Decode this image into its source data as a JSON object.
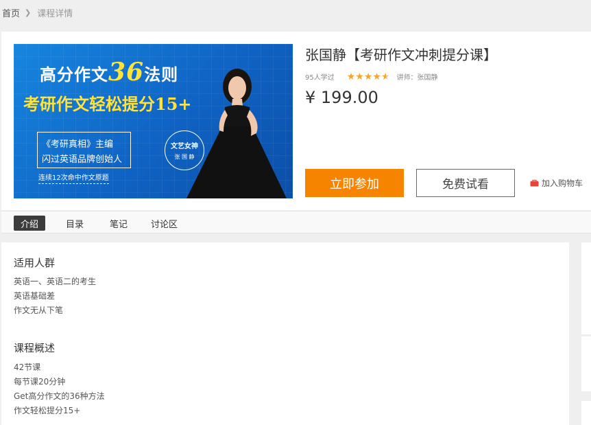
{
  "breadcrumb": {
    "home": "首页",
    "current": "课程详情"
  },
  "course": {
    "title": "张国静【考研作文冲刺提分课】",
    "learners": "95人学过",
    "rating_stars": 4.5,
    "teacher": "讲师：张国静",
    "price": "¥ 199.00",
    "join_label": "立即参加",
    "trial_label": "免费试看",
    "cart_label": "加入购物车"
  },
  "cover": {
    "line1_a": "高分作文",
    "line1_num": "36",
    "line1_b": "法则",
    "line2": "考研作文轻松提分15+",
    "box_line1": "《考研真相》主编",
    "box_line2": "闪过英语品牌创始人",
    "sub": "连续12次命中作文原题",
    "seal_line1": "文艺女神",
    "seal_line2": "张 国 静"
  },
  "tabs": [
    {
      "label": "介绍"
    },
    {
      "label": "目录"
    },
    {
      "label": "笔记"
    },
    {
      "label": "讨论区"
    }
  ],
  "sections": {
    "audience": {
      "title": "适用人群",
      "items": [
        "英语一、英语二的考生",
        "英语基础差",
        "作文无从下笔"
      ]
    },
    "overview": {
      "title": "课程概述",
      "items": [
        "42节课",
        "每节课20分钟",
        "Get高分作文的36种方法",
        "作文轻松提分15+"
      ]
    }
  },
  "colors": {
    "accent": "#f78400",
    "star": "#f5a623",
    "active_tab": "#3c3c3c",
    "cover_blue": "#1686e0",
    "cover_yellow": "#ffe23a"
  }
}
